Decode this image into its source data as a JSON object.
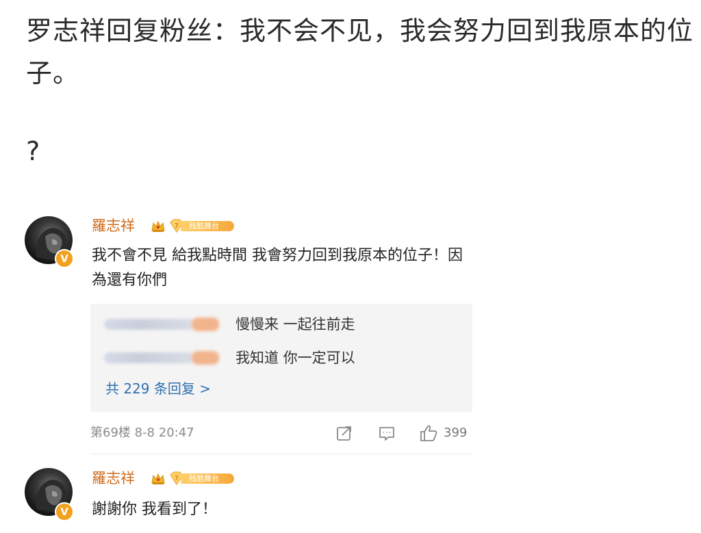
{
  "post": {
    "headline": "罗志祥回复粉丝：我不会不见，我会努力回到我原本的位子。",
    "question": "?"
  },
  "comments": [
    {
      "username": "羅志祥",
      "level_tag": "残酷舞台",
      "text": "我不會不見 給我點時間 我會努力回到我原本的位子！因為還有你們",
      "replies": [
        {
          "text": "慢慢来 一起往前走"
        },
        {
          "text": "我知道 你一定可以"
        }
      ],
      "more_replies_label": "共 229 条回复 >",
      "meta": "第69楼 8-8 20:47",
      "likes": "399"
    },
    {
      "username": "羅志祥",
      "level_tag": "残酷舞台",
      "text": "謝謝你 我看到了！"
    }
  ],
  "colors": {
    "username": "#d06a1a",
    "link": "#2f6fb0",
    "verified_badge": "#f2a01d",
    "reply_bg": "#f4f4f4"
  },
  "icons": {
    "verified": "V",
    "share": "share-icon",
    "comment": "comment-icon",
    "like": "thumbs-up-icon"
  }
}
